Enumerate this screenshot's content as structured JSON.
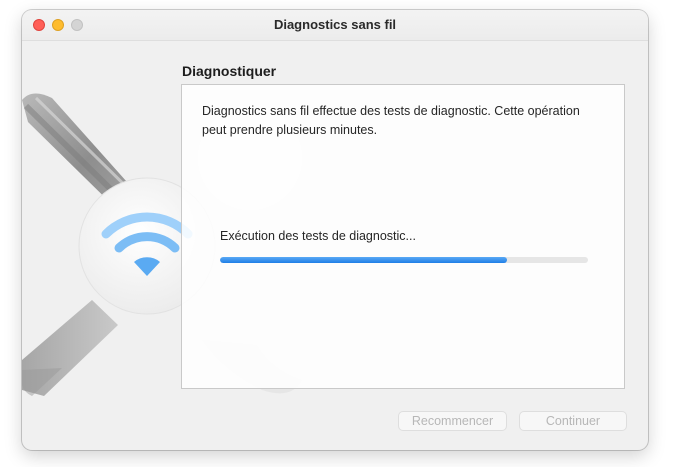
{
  "window": {
    "title": "Diagnostics sans fil"
  },
  "section": {
    "title": "Diagnostiquer"
  },
  "panel": {
    "description": "Diagnostics sans fil effectue des tests de diagnostic. Cette opération peut prendre plusieurs minutes.",
    "status": "Exécution des tests de diagnostic...",
    "progress_percent": 78
  },
  "buttons": {
    "restart_label": "Recommencer",
    "continue_label": "Continuer"
  },
  "colors": {
    "accent": "#1f7ee6",
    "wifi": "#3ea3f0",
    "close": "#ff5f57",
    "minimize": "#febc2e"
  },
  "icons": {
    "background_art": "wrench-and-screwdriver-icon",
    "badge": "wifi-icon"
  }
}
